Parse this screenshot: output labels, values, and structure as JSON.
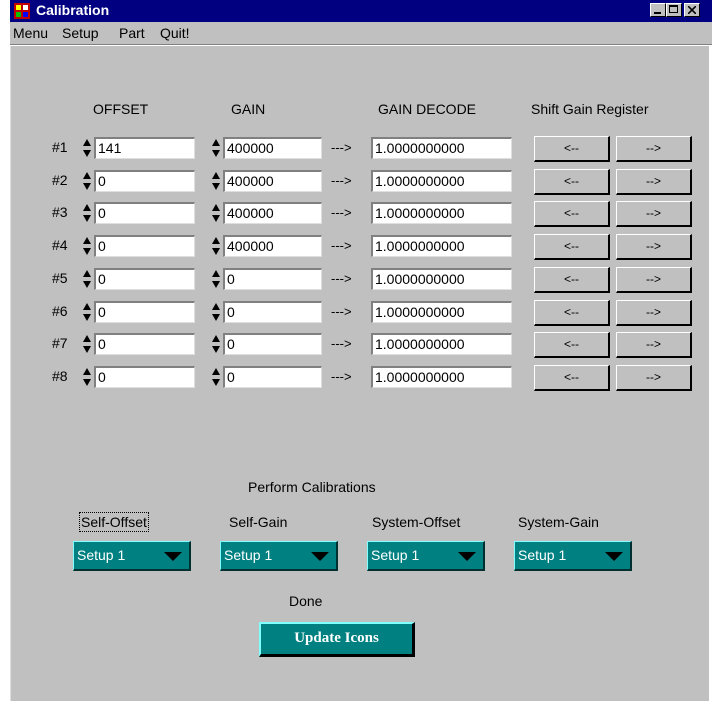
{
  "window": {
    "title": "Calibration"
  },
  "menu": [
    "Menu",
    "Setup",
    "Part",
    "Quit!"
  ],
  "headers": {
    "offset": "OFFSET",
    "gain": "GAIN",
    "gain_decode": "GAIN DECODE",
    "shift": "Shift Gain Register"
  },
  "arrow_text": "--->",
  "rows": [
    {
      "label": "#1",
      "offset": "141",
      "gain": "400000",
      "decode": "1.0000000000",
      "left_btn": "<--",
      "right_btn": "-->"
    },
    {
      "label": "#2",
      "offset": "0",
      "gain": "400000",
      "decode": "1.0000000000",
      "left_btn": "<--",
      "right_btn": "-->"
    },
    {
      "label": "#3",
      "offset": "0",
      "gain": "400000",
      "decode": "1.0000000000",
      "left_btn": "<--",
      "right_btn": "-->"
    },
    {
      "label": "#4",
      "offset": "0",
      "gain": "400000",
      "decode": "1.0000000000",
      "left_btn": "<--",
      "right_btn": "-->"
    },
    {
      "label": "#5",
      "offset": "0",
      "gain": "0",
      "decode": "1.0000000000",
      "left_btn": "<--",
      "right_btn": "-->"
    },
    {
      "label": "#6",
      "offset": "0",
      "gain": "0",
      "decode": "1.0000000000",
      "left_btn": "<--",
      "right_btn": "-->"
    },
    {
      "label": "#7",
      "offset": "0",
      "gain": "0",
      "decode": "1.0000000000",
      "left_btn": "<--",
      "right_btn": "-->"
    },
    {
      "label": "#8",
      "offset": "0",
      "gain": "0",
      "decode": "1.0000000000",
      "left_btn": "<--",
      "right_btn": "-->"
    }
  ],
  "calibrations": {
    "title": "Perform Calibrations",
    "items": [
      {
        "label": "Self-Offset",
        "value": "Setup 1"
      },
      {
        "label": "Self-Gain",
        "value": "Setup 1"
      },
      {
        "label": "System-Offset",
        "value": "Setup 1"
      },
      {
        "label": "System-Gain",
        "value": "Setup 1"
      }
    ]
  },
  "status": "Done",
  "update_button": "Update Icons",
  "colors": {
    "title_bar": "#000080",
    "panel": "#c0c0c0",
    "teal": "#008080"
  }
}
